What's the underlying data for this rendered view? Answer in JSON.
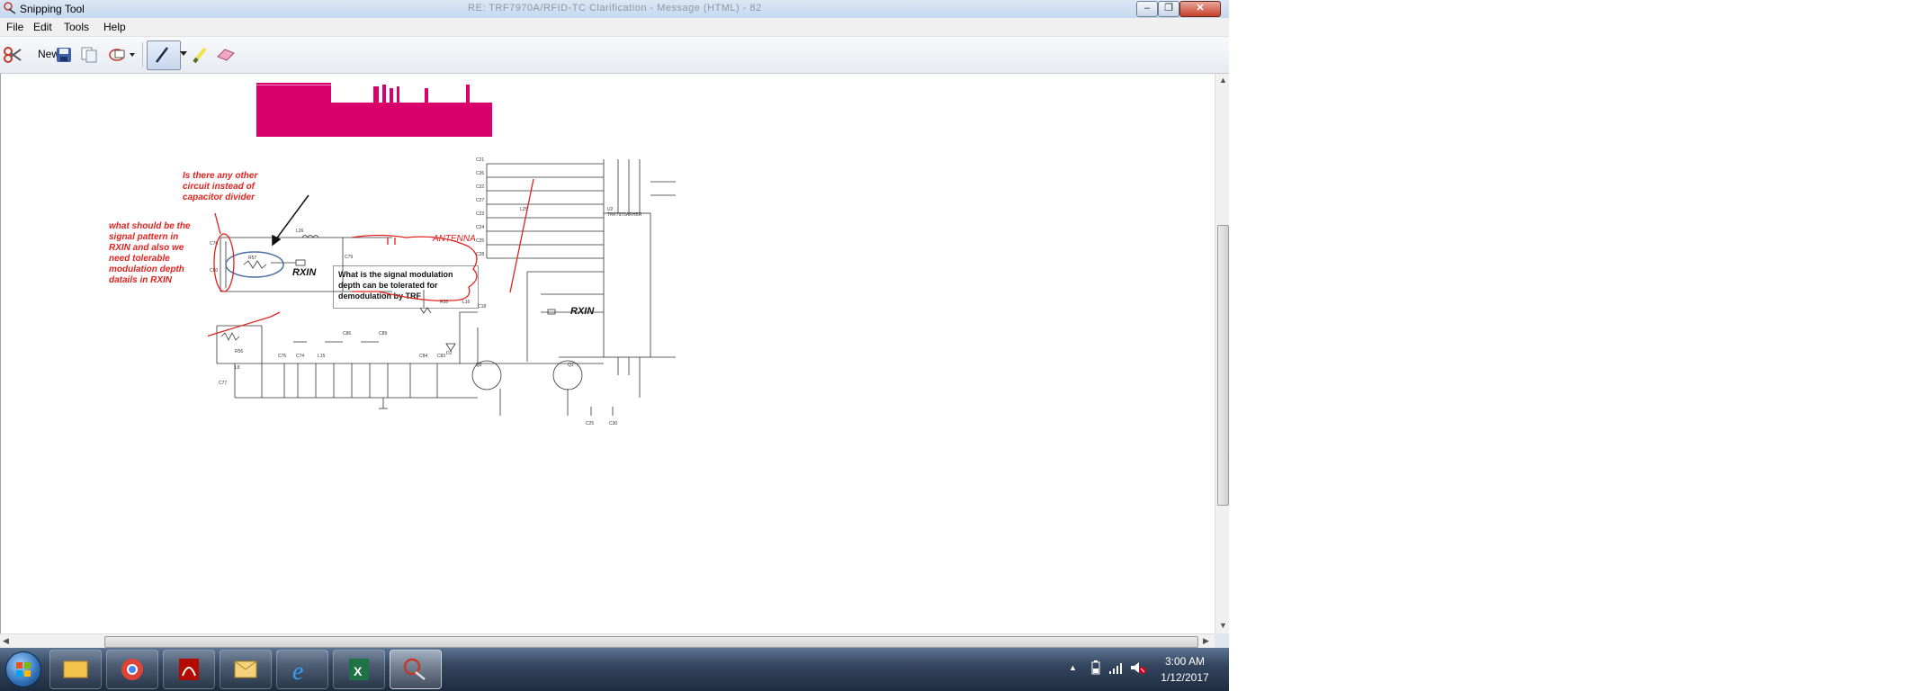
{
  "window": {
    "title": "Snipping Tool",
    "background_title": "RE: TRF7970A/RFID-TC Clarification - Message (HTML) - 82",
    "buttons": {
      "minimize": "–",
      "maximize": "❐",
      "close": "✕"
    }
  },
  "menu": {
    "items": [
      "File",
      "Edit",
      "Tools",
      "Help"
    ]
  },
  "toolbar": {
    "new_label": "New",
    "icons": [
      "scissors-icon",
      "save-icon",
      "copy-icon",
      "send-icon",
      "dropdown-icon",
      "pen-icon",
      "dropdown-icon",
      "highlighter-icon",
      "eraser-icon"
    ]
  },
  "annotations": {
    "q_capacitor": "Is there any other\ncircuit instead of\ncapacitor divider",
    "q_signal": "what should be the\nsignal pattern in\nRXIN and also we\nneed tolerable\nmodulation depth\ndatails in RXIN",
    "antenna": "ANTENNA",
    "callout": "What is the  signal modulation\ndepth can be tolerated  for\ndemodulation  by  TRF",
    "rxin_left": "RXIN",
    "rxin_right": "RXIN"
  },
  "schematic_labels": {
    "components": [
      "C78",
      "C80",
      "R57",
      "L26",
      "C79",
      "L23",
      "C21",
      "C26",
      "C22",
      "C27",
      "C23",
      "C24",
      "C25",
      "C28",
      "U2",
      "L25",
      "R55",
      "L16",
      "C18",
      "C19",
      "R56",
      "C77",
      "L8",
      "C76",
      "C74",
      "L15",
      "C86",
      "C89",
      "C81",
      "C86",
      "L17",
      "C82",
      "C84",
      "L12",
      "C85",
      "C8",
      "C83",
      "D2",
      "Q2",
      "Q1",
      "C25",
      "C30"
    ],
    "ic_name": "TRF7970ARHBR"
  },
  "taskbar": {
    "time": "3:00 AM",
    "date": "1/12/2017",
    "apps": [
      "windows-start-icon",
      "file-explorer-icon",
      "chrome-icon",
      "acrobat-icon",
      "outlook-icon",
      "internet-explorer-icon",
      "excel-icon",
      "snipping-tool-icon"
    ]
  },
  "colors": {
    "annotation_red": "#e0231f",
    "scope_magenta": "#d9006c",
    "ellipse_blue": "#4a6fa5"
  }
}
